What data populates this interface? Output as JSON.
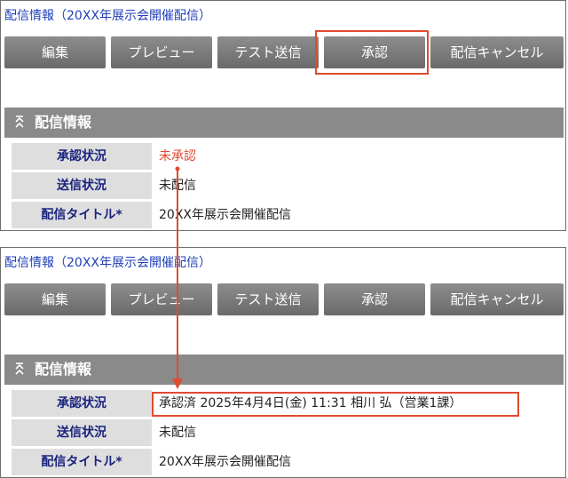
{
  "breadcrumb": "配信情報（20XX年展示会開催配信）",
  "toolbar": {
    "edit": "編集",
    "preview": "プレビュー",
    "test_send": "テスト送信",
    "approve": "承認",
    "cancel_delivery": "配信キャンセル"
  },
  "section": {
    "title": "配信情報"
  },
  "fields": {
    "approval_label": "承認状況",
    "delivery_label": "送信状況",
    "title_label": "配信タイトル*"
  },
  "before": {
    "approval_value": "未承認",
    "delivery_value": "未配信",
    "title_value": "20XX年展示会開催配信"
  },
  "after": {
    "approval_value": "承認済 2025年4月4日(金) 11:31 相川 弘（営業1課）",
    "delivery_value": "未配信",
    "title_value": "20XX年展示会開催配信"
  },
  "colors": {
    "highlight": "#e04a2f",
    "button": "#7a7a7a",
    "label_text": "#1a237e",
    "link": "#1f3fb8"
  },
  "icons": {
    "collapse": "double-chevron-up-icon"
  }
}
